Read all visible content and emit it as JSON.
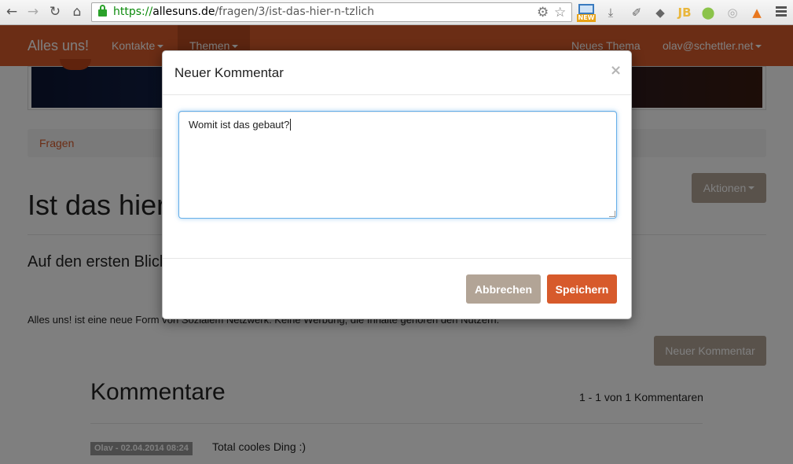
{
  "browser": {
    "url_scheme": "https://",
    "url_host": "allesuns.de",
    "url_path": "/fragen/3/ist-das-hier-n-tzlich",
    "icons": [
      "back-icon",
      "forward-icon",
      "reload-icon",
      "home-icon",
      "lock-icon",
      "settings-gear-icon",
      "star-icon",
      "new-extension-icon",
      "download-icon",
      "eyedropper-icon",
      "evernote-icon",
      "jetbrains-icon",
      "android-icon",
      "circle-extension-icon",
      "firebug-icon",
      "menu-icon"
    ],
    "new_badge": "NEW"
  },
  "navbar": {
    "brand": "Alles uns!",
    "items": [
      {
        "label": "Kontakte"
      },
      {
        "label": "Themen"
      }
    ],
    "right_items": [
      {
        "label": "Neues Thema"
      },
      {
        "label": "olav@schettler.net"
      }
    ],
    "color": "#d75a2b"
  },
  "breadcrumb": {
    "item": "Fragen"
  },
  "actions_button": "Aktionen",
  "page_title": "Ist das hier nützlich?",
  "lead_text": "Auf den ersten Blick nicht, aber auf den zweiten Blick ist Alles uns! eine Revolution.",
  "body_text": "Alles uns! ist eine neue Form von Sozialem Netzwerk. Keine Werbung, die Inhalte gehören den Nutzern.",
  "new_comment_button": "Neuer Kommentar",
  "comments": {
    "heading": "Kommentare",
    "count_text": "1 - 1 von 1 Kommentaren",
    "items": [
      {
        "meta": "Olav - 02.04.2014 08:24",
        "text": "Total cooles Ding :)"
      }
    ]
  },
  "modal": {
    "title": "Neuer Kommentar",
    "close_symbol": "×",
    "textarea_value": "Womit ist das gebaut?",
    "cancel_label": "Abbrechen",
    "save_label": "Speichern",
    "accent_color": "#d75a2b"
  }
}
